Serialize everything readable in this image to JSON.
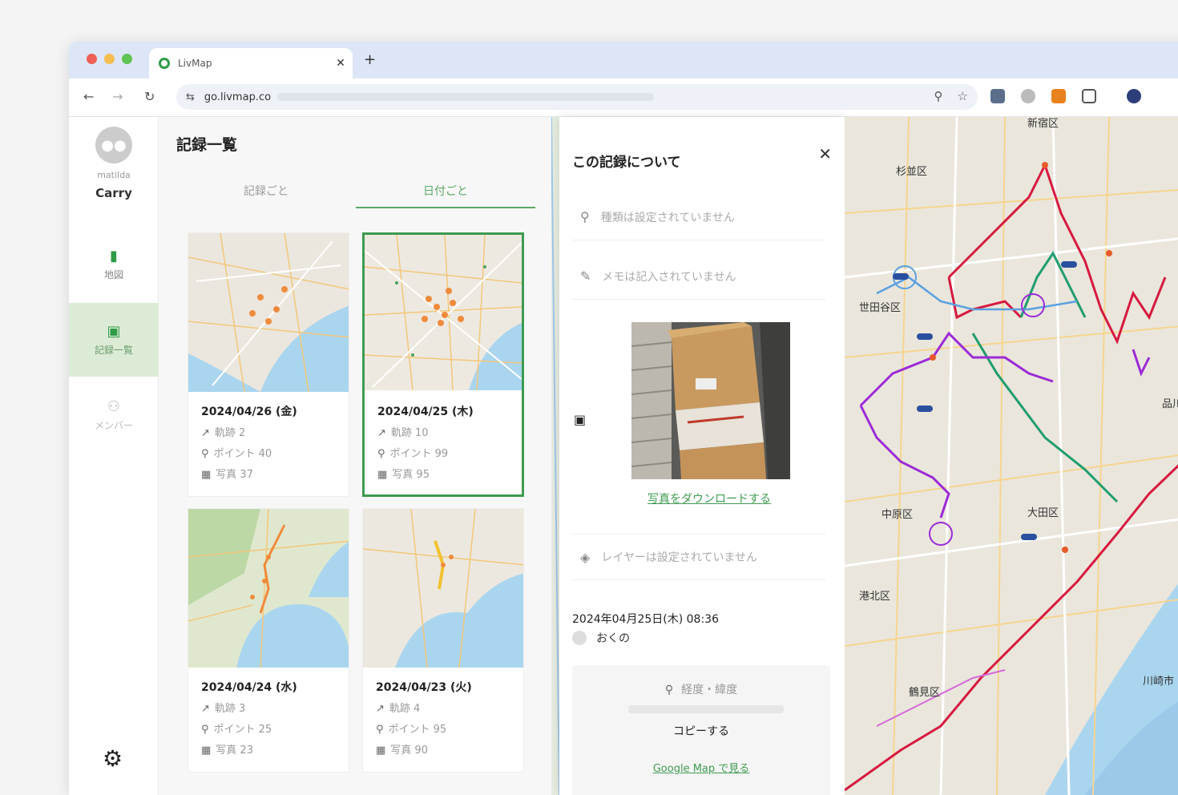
{
  "browser": {
    "tab_title": "LivMap",
    "tab_close": "✕",
    "new_tab": "+",
    "url": "go.livmap.co",
    "nav_back": "←",
    "nav_forward": "→",
    "nav_reload": "↻"
  },
  "sidebar": {
    "user_id": "matilda",
    "user_name": "Carry",
    "items": [
      {
        "label": "地図",
        "icon": "map-icon"
      },
      {
        "label": "記録一覧",
        "icon": "list-icon"
      },
      {
        "label": "メンバー",
        "icon": "members-icon"
      }
    ]
  },
  "list": {
    "title": "記録一覧",
    "tabs": [
      "記録ごと",
      "日付ごと"
    ],
    "active_tab": 1,
    "cards": [
      {
        "date": "2024/04/26 (金)",
        "tracks": "軌跡 2",
        "points": "ポイント 40",
        "photos": "写真 37"
      },
      {
        "date": "2024/04/25 (木)",
        "tracks": "軌跡 10",
        "points": "ポイント 99",
        "photos": "写真 95"
      },
      {
        "date": "2024/04/24 (水)",
        "tracks": "軌跡 3",
        "points": "ポイント 25",
        "photos": "写真 23"
      },
      {
        "date": "2024/04/23 (火)",
        "tracks": "軌跡 4",
        "points": "ポイント 95",
        "photos": "写真 90"
      }
    ]
  },
  "detail": {
    "title": "この記録について",
    "close": "✕",
    "type_placeholder": "種類は設定されていません",
    "memo_placeholder": "メモは記入されていません",
    "download_photo": "写真をダウンロードする",
    "layer_placeholder": "レイヤーは設定されていません",
    "datetime": "2024年04月25日(木) 08:36",
    "user": "おくの",
    "coord_label": "経度・緯度",
    "copy": "コピーする",
    "google_map": "Google Map で見る"
  },
  "map": {
    "labels": [
      "新宿区",
      "杉並区",
      "世田谷区",
      "中原区",
      "大田区",
      "品川区",
      "港北区",
      "鶴見区",
      "川崎市"
    ]
  },
  "colors": {
    "accent": "#3e9b51",
    "route_red": "#d7193f",
    "route_green": "#1f9d6e",
    "route_purple": "#9b2bd6",
    "route_blue": "#5aa0e0"
  }
}
